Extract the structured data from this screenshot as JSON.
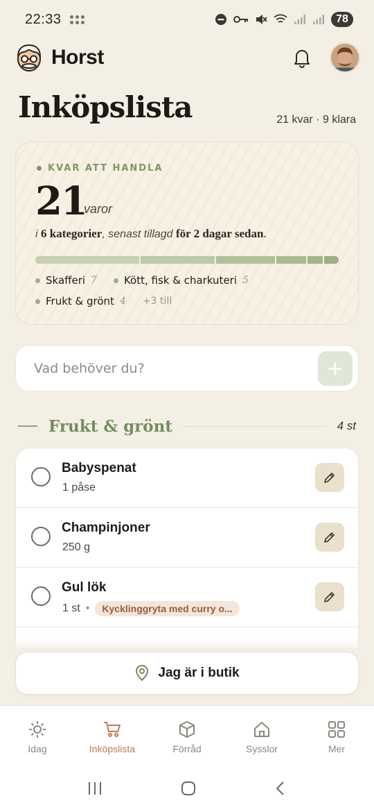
{
  "status": {
    "time": "22:33",
    "battery": "78"
  },
  "app": {
    "name": "Horst"
  },
  "page": {
    "title": "Inköpslista",
    "meta": "21 kvar · 9 klara"
  },
  "summary": {
    "label": "KVAR ATT HANDLA",
    "count": "21",
    "unit": "varor",
    "line_prefix": "i ",
    "categories_text": "6 kategorier",
    "line_middle": ", senast tillagd ",
    "added_text": "för 2 dagar sedan",
    "line_suffix": ".",
    "progress_segments": [
      {
        "color": "#c6d1b3",
        "value": 7
      },
      {
        "color": "#bccaa8",
        "value": 5
      },
      {
        "color": "#b0c09b",
        "value": 4
      },
      {
        "color": "#a9bb93",
        "value": 2
      },
      {
        "color": "#a3b58c",
        "value": 1
      },
      {
        "color": "#9caf85",
        "value": 1
      }
    ],
    "categories": [
      {
        "name": "Skafferi",
        "count": "7"
      },
      {
        "name": "Kött, fisk & charkuteri",
        "count": "5"
      },
      {
        "name": "Frukt & grönt",
        "count": "4"
      }
    ],
    "more": "+3 till"
  },
  "search": {
    "placeholder": "Vad behöver du?",
    "value": ""
  },
  "section": {
    "title": "Frukt & grönt",
    "count": "4 st"
  },
  "items": [
    {
      "name": "Babyspenat",
      "qty": "1 påse",
      "tag": ""
    },
    {
      "name": "Champinjoner",
      "qty": "250 g",
      "tag": ""
    },
    {
      "name": "Gul lök",
      "qty": "1 st",
      "tag": "Kycklinggryta med curry o..."
    }
  ],
  "store_button": "Jag är i butik",
  "tabs": [
    {
      "label": "Idag",
      "icon": "sun-icon"
    },
    {
      "label": "Inköpslista",
      "icon": "cart-icon"
    },
    {
      "label": "Förråd",
      "icon": "box-icon"
    },
    {
      "label": "Sysslor",
      "icon": "house-icon"
    },
    {
      "label": "Mer",
      "icon": "grid-icon"
    }
  ],
  "colors": {
    "accent_green": "#758d5e",
    "accent_orange": "#c17a4f",
    "background": "#f3efe4"
  }
}
